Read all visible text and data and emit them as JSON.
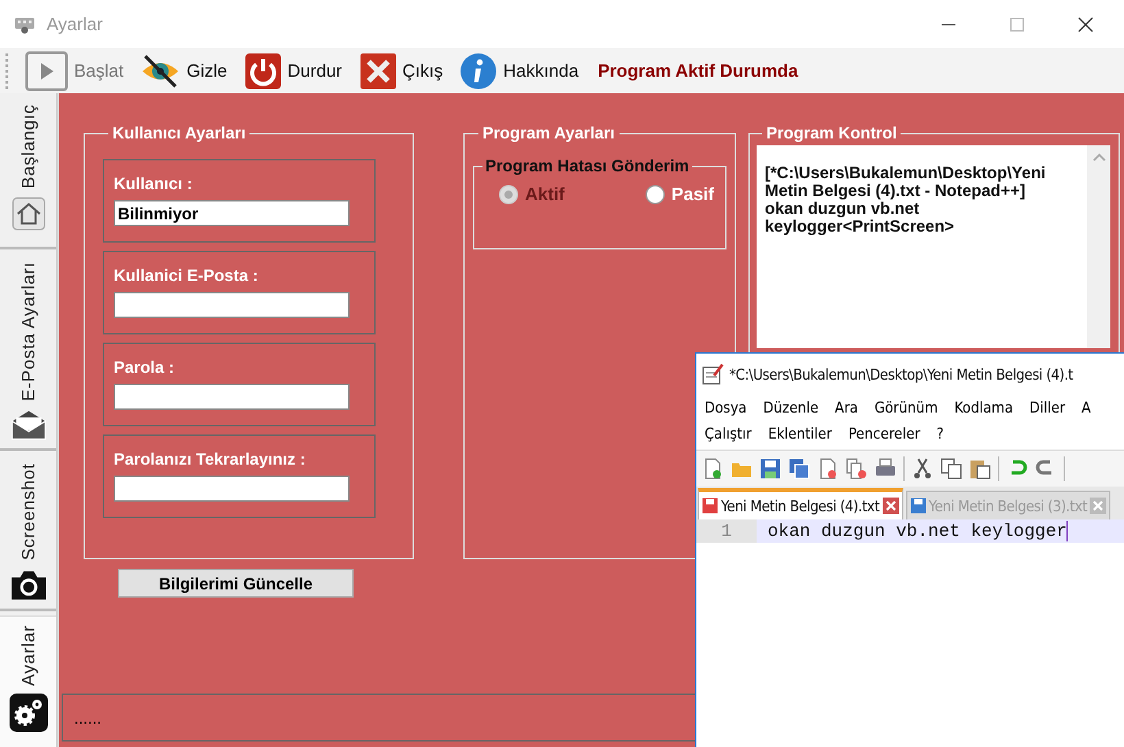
{
  "window": {
    "title": "Ayarlar"
  },
  "toolbar": {
    "items": [
      {
        "kind": "play",
        "label": "Başlat",
        "disabled": true
      },
      {
        "kind": "hide",
        "label": "Gizle",
        "disabled": false
      },
      {
        "kind": "stop",
        "label": "Durdur",
        "disabled": false
      },
      {
        "kind": "exit",
        "label": "Çıkış",
        "disabled": false
      },
      {
        "kind": "info",
        "label": "Hakkında",
        "disabled": false
      }
    ],
    "status": "Program Aktif Durumda"
  },
  "side_tabs": [
    {
      "kind": "home",
      "label": "Başlangıç",
      "selected": false
    },
    {
      "kind": "mail",
      "label": "E-Posta Ayarları",
      "selected": false
    },
    {
      "kind": "camera",
      "label": "Screenshot",
      "selected": false
    },
    {
      "kind": "gears",
      "label": "Ayarlar",
      "selected": true
    }
  ],
  "user_settings": {
    "title": "Kullanıcı Ayarları",
    "fields": [
      {
        "label": "Kullanıcı :",
        "value": "Bilinmiyor"
      },
      {
        "label": "Kullanici E-Posta :"
      },
      {
        "label": "Parola :"
      },
      {
        "label": "Parolanızı Tekrarlayınız :"
      }
    ],
    "button": "Bilgilerimi Güncelle"
  },
  "program_settings": {
    "title": "Program Ayarları",
    "group": {
      "title": "Program Hatası Gönderim",
      "options": [
        {
          "label": "Aktif",
          "selected": true
        },
        {
          "label": "Pasif",
          "selected": false
        }
      ]
    }
  },
  "program_control": {
    "title": "Program Kontrol",
    "log": [
      "[*C:\\Users\\Bukalemun\\Desktop\\Yeni",
      "Metin Belgesi (4).txt - Notepad++]",
      "okan duzgun vb.net",
      "keylogger<PrintScreen>"
    ]
  },
  "status_text": "......",
  "notepad": {
    "title": "*C:\\Users\\Bukalemun\\Desktop\\Yeni Metin Belgesi (4).t",
    "menu_rows": [
      [
        "Dosya",
        "Düzenle",
        "Ara",
        "Görünüm",
        "Kodlama",
        "Diller",
        "A"
      ],
      [
        "Çalıştır",
        "Eklentiler",
        "Pencereler",
        "?"
      ]
    ],
    "tabs": [
      {
        "label": "Yeni Metin Belgesi (4).txt",
        "selected": true
      },
      {
        "label": "Yeni Metin Belgesi (3).txt",
        "selected": false
      }
    ],
    "lines": [
      {
        "number": "1",
        "text": "okan duzgun vb.net keylogger"
      }
    ]
  }
}
